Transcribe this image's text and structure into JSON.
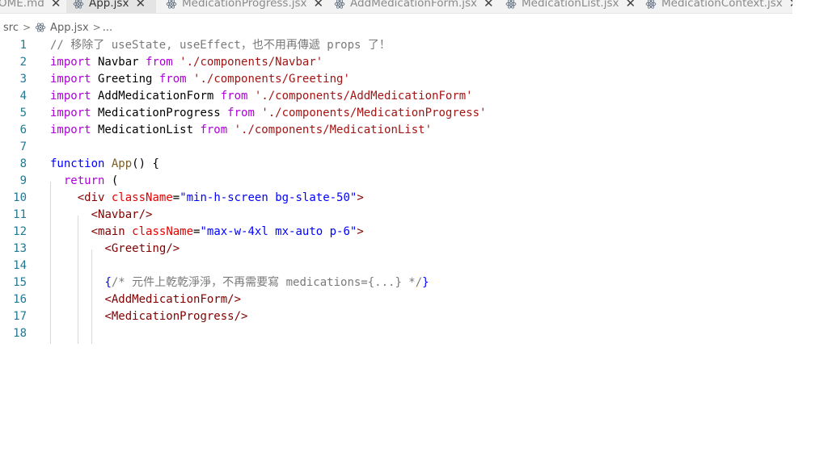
{
  "tabs": [
    {
      "label": "OME.md",
      "active": false,
      "icon": "markdown-file-icon"
    },
    {
      "label": "App.jsx",
      "active": true,
      "icon": "react-icon"
    },
    {
      "label": "MedicationProgress.jsx",
      "active": false,
      "icon": "react-icon"
    },
    {
      "label": "AddMedicationForm.jsx",
      "active": false,
      "icon": "react-icon"
    },
    {
      "label": "MedicationList.jsx",
      "active": false,
      "icon": "react-icon"
    },
    {
      "label": "MedicationContext.jsx",
      "active": false,
      "icon": "react-icon"
    }
  ],
  "close_glyph": "✕",
  "breadcrumb": {
    "folder": "src",
    "file": "App.jsx",
    "trail": "..."
  },
  "colors": {
    "keyword": "#af00db",
    "string": "#a31515",
    "tag": "#800000",
    "attr": "#e50000",
    "line_number": "#237893"
  },
  "lines": [
    {
      "n": "1",
      "tokens": [
        [
          "com",
          "// 移除了 useState, useEffect，也不用再傳遞 props 了！"
        ]
      ]
    },
    {
      "n": "2",
      "tokens": [
        [
          "kw",
          "import"
        ],
        [
          "plain",
          " Navbar "
        ],
        [
          "kw",
          "from"
        ],
        [
          "plain",
          " "
        ],
        [
          "str",
          "'./components/Navbar'"
        ]
      ]
    },
    {
      "n": "3",
      "tokens": [
        [
          "kw",
          "import"
        ],
        [
          "plain",
          " Greeting "
        ],
        [
          "kw",
          "from"
        ],
        [
          "plain",
          " "
        ],
        [
          "str",
          "'./components/Greeting'"
        ]
      ]
    },
    {
      "n": "4",
      "tokens": [
        [
          "kw",
          "import"
        ],
        [
          "plain",
          " AddMedicationForm "
        ],
        [
          "kw",
          "from"
        ],
        [
          "plain",
          " "
        ],
        [
          "str",
          "'./components/AddMedicationForm'"
        ]
      ]
    },
    {
      "n": "5",
      "tokens": [
        [
          "kw",
          "import"
        ],
        [
          "plain",
          " MedicationProgress "
        ],
        [
          "kw",
          "from"
        ],
        [
          "plain",
          " "
        ],
        [
          "str",
          "'./components/MedicationProgress'"
        ]
      ]
    },
    {
      "n": "6",
      "tokens": [
        [
          "kw",
          "import"
        ],
        [
          "plain",
          " MedicationList "
        ],
        [
          "kw",
          "from"
        ],
        [
          "plain",
          " "
        ],
        [
          "str",
          "'./components/MedicationList'"
        ]
      ]
    },
    {
      "n": "7",
      "tokens": []
    },
    {
      "n": "8",
      "tokens": [
        [
          "kwb",
          "function"
        ],
        [
          "plain",
          " "
        ],
        [
          "fn",
          "App"
        ],
        [
          "plain",
          "() {"
        ]
      ]
    },
    {
      "n": "9",
      "tokens": [
        [
          "plain",
          "  "
        ],
        [
          "kw",
          "return"
        ],
        [
          "plain",
          " ("
        ]
      ]
    },
    {
      "n": "10",
      "tokens": [
        [
          "plain",
          "    "
        ],
        [
          "punc",
          "<"
        ],
        [
          "tag",
          "div"
        ],
        [
          "plain",
          " "
        ],
        [
          "attr",
          "className"
        ],
        [
          "plain",
          "="
        ],
        [
          "kwb",
          "\"min-h-screen bg-slate-50\""
        ],
        [
          "punc",
          ">"
        ]
      ]
    },
    {
      "n": "11",
      "tokens": [
        [
          "plain",
          "      "
        ],
        [
          "punc",
          "<"
        ],
        [
          "tag",
          "Navbar"
        ],
        [
          "punc",
          "/>"
        ]
      ]
    },
    {
      "n": "12",
      "tokens": [
        [
          "plain",
          "      "
        ],
        [
          "punc",
          "<"
        ],
        [
          "tag",
          "main"
        ],
        [
          "plain",
          " "
        ],
        [
          "attr",
          "className"
        ],
        [
          "plain",
          "="
        ],
        [
          "kwb",
          "\"max-w-4xl mx-auto p-6\""
        ],
        [
          "punc",
          ">"
        ]
      ]
    },
    {
      "n": "13",
      "tokens": [
        [
          "plain",
          "        "
        ],
        [
          "punc",
          "<"
        ],
        [
          "tag",
          "Greeting"
        ],
        [
          "punc",
          "/>"
        ]
      ]
    },
    {
      "n": "14",
      "tokens": []
    },
    {
      "n": "15",
      "tokens": [
        [
          "plain",
          "        "
        ],
        [
          "kwb",
          "{"
        ],
        [
          "com",
          "/* 元件上乾乾淨淨，不再需要寫 medications={...} */"
        ],
        [
          "kwb",
          "}"
        ]
      ]
    },
    {
      "n": "16",
      "tokens": [
        [
          "plain",
          "        "
        ],
        [
          "punc",
          "<"
        ],
        [
          "tag",
          "AddMedicationForm"
        ],
        [
          "punc",
          "/>"
        ]
      ]
    },
    {
      "n": "17",
      "tokens": [
        [
          "plain",
          "        "
        ],
        [
          "punc",
          "<"
        ],
        [
          "tag",
          "MedicationProgress"
        ],
        [
          "punc",
          "/>"
        ]
      ]
    },
    {
      "n": "18",
      "tokens": []
    }
  ]
}
